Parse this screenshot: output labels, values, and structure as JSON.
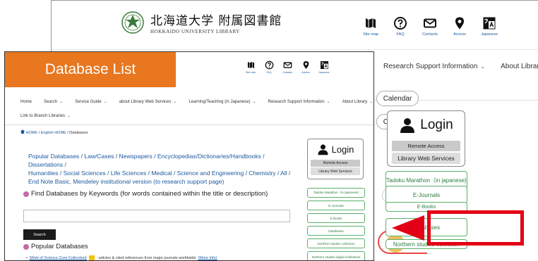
{
  "background_page": {
    "logo": {
      "jp": "北海道大学 附属図書館",
      "en": "HOKKAIDO UNIVERSITY LIBRARY"
    },
    "utility": [
      {
        "label": "Site map",
        "icon": "map-icon"
      },
      {
        "label": "FAQ",
        "icon": "question-icon"
      },
      {
        "label": "Contacts",
        "icon": "mail-icon"
      },
      {
        "label": "Access",
        "icon": "location-pin-icon"
      },
      {
        "label": "Japanese",
        "icon": "translate-icon"
      }
    ],
    "nav": [
      "Research Support Information",
      "About Library"
    ],
    "calendar_label": "Calendar",
    "login": {
      "title": "Login",
      "remote": "Remote Access",
      "services": "Library Web Services"
    },
    "side": [
      "Tadoku Marathon（in japanese)",
      "E-Journals",
      "E-Books",
      "Databases",
      "Northern studies collection"
    ]
  },
  "page": {
    "title": "Database List",
    "utility": [
      {
        "label": "Site map"
      },
      {
        "label": "FAQ"
      },
      {
        "label": "Contacts"
      },
      {
        "label": "Access"
      },
      {
        "label": "Japanese"
      }
    ],
    "nav": [
      "Home",
      "Search",
      "Service Guide",
      "about Library Web Services",
      "Learning/Teaching (in Japanese)",
      "Research Support Information",
      "About Library",
      "Link to Branch Libraries"
    ],
    "breadcrumb": {
      "home": "HOME",
      "english_home": "English HOME",
      "current": "Databases",
      "sep": "/"
    },
    "category_lines": [
      "Popular Databases / Law/Cases / Newspapers / Encyclopedias/Dictionaries/Handbooks /",
      "Dissertations /",
      "Humanities / Social Sciences / Life Sciences / Medical / Science and Engineering / Chemistry / All /",
      "End Note Basic, Mendeley institutional version (to research support page)"
    ],
    "find_heading": "Find Databases by Keywords (for words contained within the title or description)",
    "search_button": "Search",
    "popular_heading": "Popular Databases",
    "first_item": {
      "link": "[Web of Science Core Collection]",
      "desc": ": articles & cited references from major journals worldwide",
      "more": "(More Info)"
    },
    "login": {
      "title": "Login",
      "remote": "Remote Access",
      "services": "Library Web Services"
    },
    "side": [
      "Tadoku Marathon（in japanese)",
      "E-Journals",
      "E-Books",
      "Databases",
      "Northern studies collection",
      "Northern studies digital exhibitions"
    ]
  },
  "colors": {
    "title_bg": "#e8771f",
    "link": "#1d5aa0",
    "highlight": "#e30016",
    "side_border": "#5bb06a",
    "heading_dot": "#c56aa6"
  }
}
